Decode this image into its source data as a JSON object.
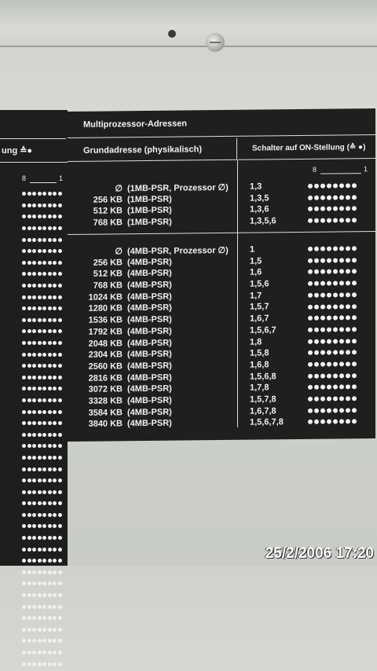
{
  "header": {
    "title": "Multiprozessor-Adressen",
    "col_left": "Grundadresse (physikalisch)",
    "col_right": "Schalter auf ON-Stellung (≙ ●)"
  },
  "left_panel": {
    "subheader": "ung ≙●",
    "scale_left": "8",
    "scale_right": "1",
    "rows": 42
  },
  "scale": {
    "left": "8",
    "right": "1"
  },
  "block1": [
    {
      "size": "∅",
      "desc": "(1MB-PSR, Prozessor ∅)",
      "switches": "1,3"
    },
    {
      "size": "256 KB",
      "desc": "(1MB-PSR)",
      "switches": "1,3,5"
    },
    {
      "size": "512 KB",
      "desc": "(1MB-PSR)",
      "switches": "1,3,6"
    },
    {
      "size": "768 KB",
      "desc": "(1MB-PSR)",
      "switches": "1,3,5,6"
    }
  ],
  "block2": [
    {
      "size": "∅",
      "desc": "(4MB-PSR, Prozessor ∅)",
      "switches": "1"
    },
    {
      "size": "256 KB",
      "desc": "(4MB-PSR)",
      "switches": "1,5"
    },
    {
      "size": "512 KB",
      "desc": "(4MB-PSR)",
      "switches": "1,6"
    },
    {
      "size": "768 KB",
      "desc": "(4MB-PSR)",
      "switches": "1,5,6"
    },
    {
      "size": "1024 KB",
      "desc": "(4MB-PSR)",
      "switches": "1,7"
    },
    {
      "size": "1280 KB",
      "desc": "(4MB-PSR)",
      "switches": "1,5,7"
    },
    {
      "size": "1536 KB",
      "desc": "(4MB-PSR)",
      "switches": "1,6,7"
    },
    {
      "size": "1792 KB",
      "desc": "(4MB-PSR)",
      "switches": "1,5,6,7"
    },
    {
      "size": "2048 KB",
      "desc": "(4MB-PSR)",
      "switches": "1,8"
    },
    {
      "size": "2304 KB",
      "desc": "(4MB-PSR)",
      "switches": "1,5,8"
    },
    {
      "size": "2560 KB",
      "desc": "(4MB-PSR)",
      "switches": "1,6,8"
    },
    {
      "size": "2816 KB",
      "desc": "(4MB-PSR)",
      "switches": "1,5,6,8"
    },
    {
      "size": "3072 KB",
      "desc": "(4MB-PSR)",
      "switches": "1,7,8"
    },
    {
      "size": "3328 KB",
      "desc": "(4MB-PSR)",
      "switches": "1,5,7,8"
    },
    {
      "size": "3584 KB",
      "desc": "(4MB-PSR)",
      "switches": "1,6,7,8"
    },
    {
      "size": "3840 KB",
      "desc": "(4MB-PSR)",
      "switches": "1,5,6,7,8"
    }
  ],
  "timestamp": "25/2/2006 17:20"
}
